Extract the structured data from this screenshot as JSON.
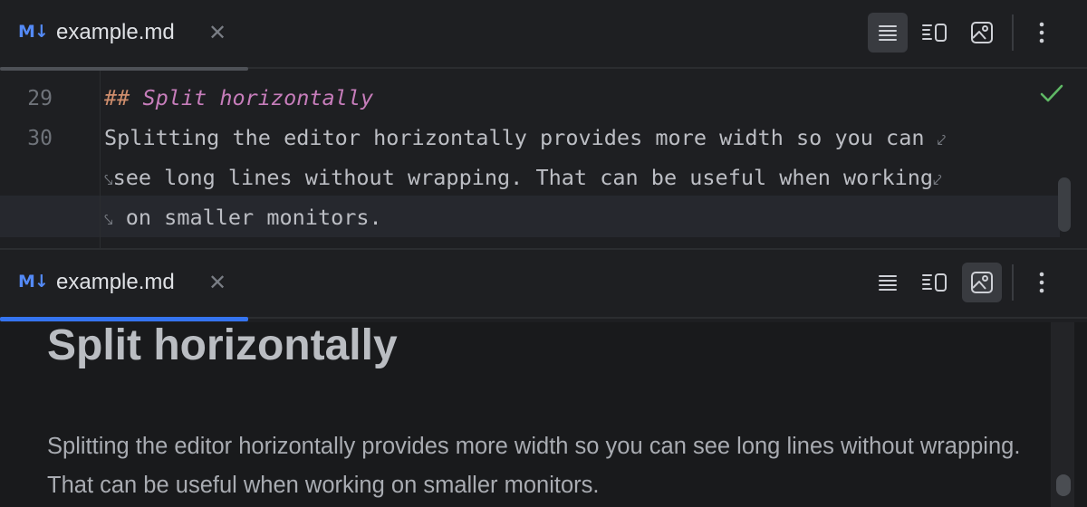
{
  "top_pane": {
    "tab": {
      "icon": "M↓",
      "name": "example.md",
      "close": "✕"
    },
    "toolbar": {
      "editor_only": "editor-only-icon",
      "split": "split-editor-preview-icon",
      "preview_only": "preview-only-icon",
      "more": "more-vertical-icon",
      "selected": "editor_only"
    },
    "editor": {
      "lines": [
        {
          "number": "29",
          "marks": "## ",
          "text": "Split horizontally"
        },
        {
          "number": "30",
          "text": "Splitting the editor horizontally provides more width so you can ",
          "wrap": "⤦"
        },
        {
          "text": "see long lines without wrapping. That can be useful when working",
          "wrap_start": "⤥",
          "wrap": "⤦"
        },
        {
          "text": " on smaller monitors.",
          "wrap_start": "⤥"
        }
      ],
      "status_icon": "check-icon",
      "colors": {
        "heading": "#c77dbb",
        "marks": "#cf8e6d",
        "text": "#bcbec4"
      }
    }
  },
  "bottom_pane": {
    "tab": {
      "icon": "M↓",
      "name": "example.md",
      "close": "✕"
    },
    "toolbar": {
      "editor_only": "editor-only-icon",
      "split": "split-editor-preview-icon",
      "preview_only": "preview-only-icon",
      "more": "more-vertical-icon",
      "selected": "preview_only"
    },
    "preview": {
      "heading": "Split horizontally",
      "paragraph": "Splitting the editor horizontally provides more width so you can see long lines without wrapping. That can be useful when working on smaller monitors."
    }
  },
  "accent_color": "#3574f0"
}
